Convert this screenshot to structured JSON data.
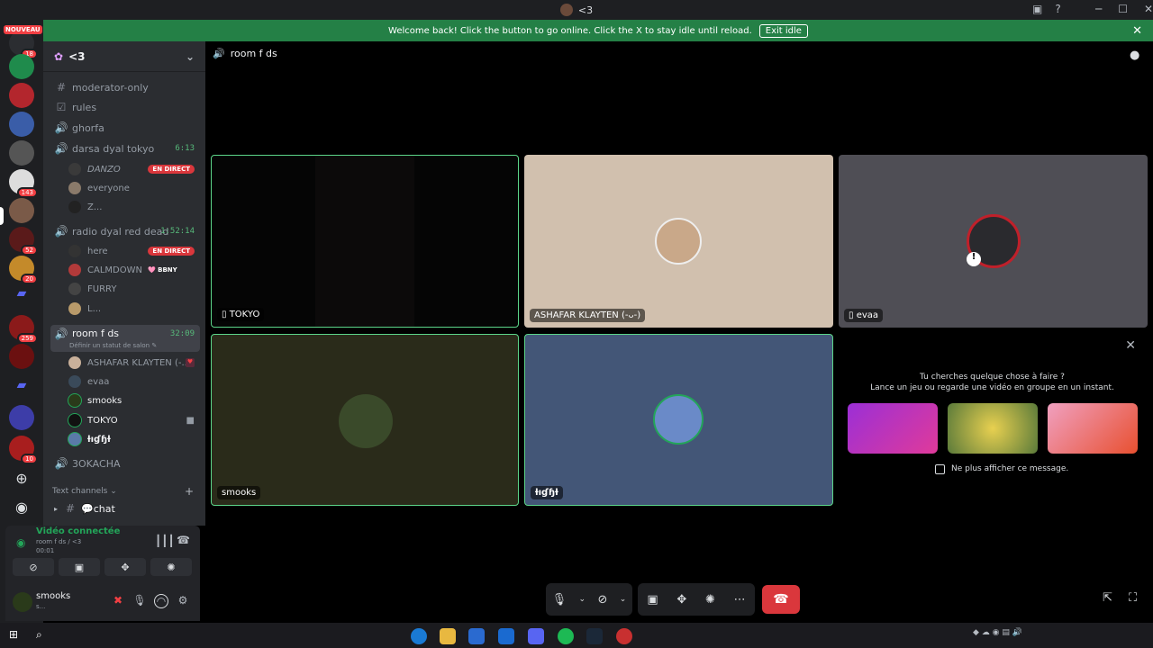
{
  "window": {
    "title": "<3",
    "controls": [
      "─",
      "☐",
      "✕"
    ]
  },
  "banner": {
    "text": "Welcome back! Click the button to go online. Click the X to stay idle until reload.",
    "button": "Exit idle"
  },
  "rail": {
    "new_badge": "NOUVEAU",
    "badges": [
      "18",
      "143",
      "52",
      "20",
      "259",
      "10"
    ]
  },
  "server": {
    "name": "<3"
  },
  "channels": [
    {
      "name": "moderator-only",
      "icon": "#"
    },
    {
      "name": "rules",
      "icon": "☑"
    },
    {
      "name": "ghorfa",
      "icon": "🔊"
    },
    {
      "name": "darsa dyal tokyo",
      "icon": "🔊",
      "time": "6:13"
    },
    {
      "name": "radio dyal red dead",
      "icon": "🔊",
      "time": "1:52:14"
    },
    {
      "name": "room f ds",
      "icon": "🔊",
      "time": "32:09",
      "status_hint": "Définir un statut de salon ✎"
    },
    {
      "name": "3OKACHA",
      "icon": "🔊"
    }
  ],
  "users": {
    "darsa": [
      {
        "name": "DANZO",
        "live": "EN DIRECT"
      },
      {
        "name": "everyone"
      },
      {
        "name": "Z..."
      }
    ],
    "radio": [
      {
        "name": "here",
        "live": "EN DIRECT"
      },
      {
        "name": "CALMDOWN",
        "tag": "BBNY"
      },
      {
        "name": "FURRY"
      },
      {
        "name": "L..."
      }
    ],
    "room": [
      {
        "name": "ASHAFAR KLAYTEN (-..."
      },
      {
        "name": "evaa"
      },
      {
        "name": "smooks"
      },
      {
        "name": "TOKYO"
      },
      {
        "name": "ƚıɠɧƚ"
      }
    ]
  },
  "text_channels": {
    "category": "Text channels ⌄",
    "items": [
      {
        "name": "💬chat"
      }
    ]
  },
  "voice": {
    "status": "Vidéo connectée",
    "channel": "room f ds / <3",
    "timer": "00:01"
  },
  "userbar": {
    "name": "smooks",
    "status": "s..."
  },
  "main": {
    "header": "room f ds"
  },
  "tiles": [
    {
      "name": "TOKYO",
      "icon": "▯"
    },
    {
      "name": "ASHAFAR KLAYTEN (-ᴗ-)"
    },
    {
      "name": "evaa",
      "icon": "▯"
    },
    {
      "name": "smooks"
    },
    {
      "name": "ƚıɠɧƚ"
    }
  ],
  "activity": {
    "q1": "Tu cherches quelque chose à faire ?",
    "q2": "Lance un jeu ou regarde une vidéo en groupe en un instant.",
    "checkbox": "Ne plus afficher ce message.",
    "games": [
      "game-blocks",
      "game-puzzle",
      "game-bobble-league"
    ]
  },
  "colors": {
    "accent_green": "#23a559",
    "danger": "#da373c",
    "banner": "#248046",
    "tile_beige": "#d1c0ae",
    "tile_gray": "#4f4e55",
    "tile_olive": "#2a2b1a",
    "tile_blue": "#435677"
  }
}
